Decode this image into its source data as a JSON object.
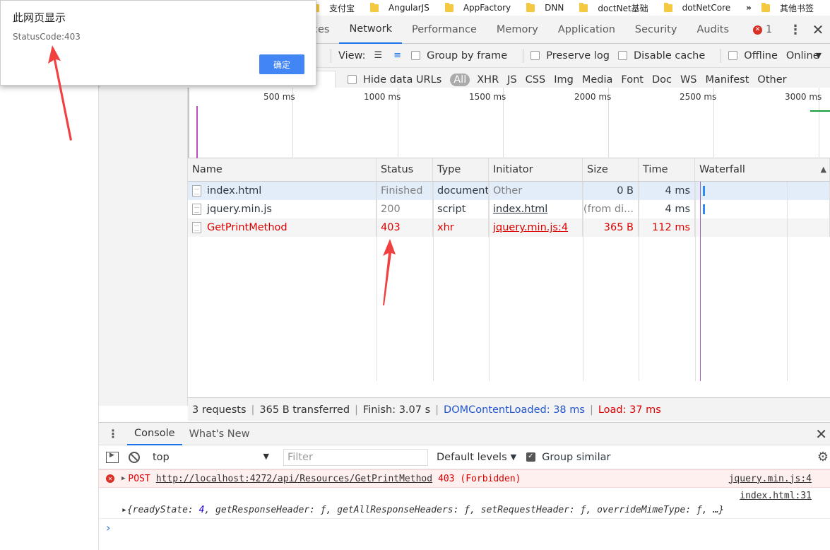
{
  "bookmarks": [
    "支付宝",
    "AngularJS",
    "AppFactory",
    "DNN",
    "doctNet基础",
    "dotNetCore"
  ],
  "bookmarks_more": "»",
  "bookmarks_other": "其他书签",
  "dialog": {
    "title": "此网页显示",
    "message": "StatusCode:403",
    "ok_label": "确定"
  },
  "devtools": {
    "tabs": [
      "ces",
      "Network",
      "Performance",
      "Memory",
      "Application",
      "Security",
      "Audits"
    ],
    "error_count": "1",
    "toolbar1": {
      "view_label": "View:",
      "group_by_frame": "Group by frame",
      "preserve_log": "Preserve log",
      "disable_cache": "Disable cache",
      "offline": "Offline",
      "online": "Online"
    },
    "toolbar2": {
      "hide_data_urls": "Hide data URLs",
      "all": "All",
      "types": [
        "XHR",
        "JS",
        "CSS",
        "Img",
        "Media",
        "Font",
        "Doc",
        "WS",
        "Manifest",
        "Other"
      ]
    },
    "overview_ticks": [
      "500 ms",
      "1000 ms",
      "1500 ms",
      "2000 ms",
      "2500 ms",
      "3000 ms"
    ],
    "columns": [
      "Name",
      "Status",
      "Type",
      "Initiator",
      "Size",
      "Time",
      "Waterfall"
    ],
    "rows": [
      {
        "name": "index.html",
        "status": "Finished",
        "type": "document",
        "initiator": "Other",
        "size": "0 B",
        "time": "4 ms"
      },
      {
        "name": "jquery.min.js",
        "status": "200",
        "type": "script",
        "initiator": "index.html",
        "size": "(from di...",
        "time": "4 ms"
      },
      {
        "name": "GetPrintMethod",
        "status": "403",
        "type": "xhr",
        "initiator": "jquery.min.js:4",
        "size": "365 B",
        "time": "112 ms"
      }
    ],
    "summary": {
      "requests": "3 requests",
      "transferred": "365 B transferred",
      "finish": "Finish: 3.07 s",
      "dom_loaded": "DOMContentLoaded: 38 ms",
      "load": "Load: 37 ms"
    }
  },
  "console": {
    "tabs": [
      "Console",
      "What's New"
    ],
    "context": "top",
    "filter_placeholder": "Filter",
    "levels": "Default levels",
    "group_similar": "Group similar",
    "error_msg": {
      "method": "POST",
      "url": "http://localhost:4272/api/Resources/GetPrintMethod",
      "status": "403 (Forbidden)",
      "source": "jquery.min.js:4"
    },
    "log_msg": {
      "source": "index.html:31",
      "prefix": "{readyState: ",
      "ready_state": "4",
      "rest": ", getResponseHeader: ƒ, getAllResponseHeaders: ƒ, setRequestHeader: ƒ, overrideMimeType: ƒ, …}"
    }
  },
  "colors": {
    "error_red": "#d00000",
    "accent_blue": "#1a73e8",
    "arrow_red": "#f04040"
  }
}
